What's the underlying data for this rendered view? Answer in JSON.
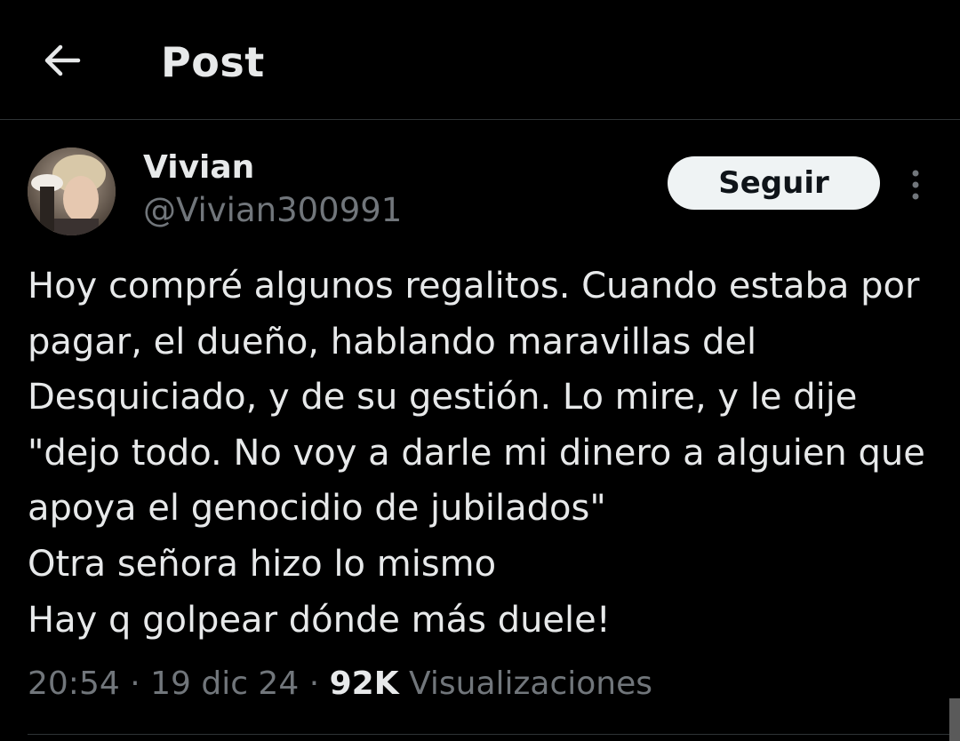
{
  "header": {
    "back_icon": "arrow-left-icon",
    "title": "Post"
  },
  "post": {
    "author": {
      "name": "Vivian",
      "handle": "@Vivian300991",
      "avatar": "user-avatar-photo"
    },
    "follow_label": "Seguir",
    "more_icon": "more-vertical-icon",
    "text": "Hoy compré algunos regalitos. Cuando estaba por pagar, el dueño, hablando maravillas del Desquiciado, y de su gestión. Lo mire, y le dije \"dejo todo. No voy a darle mi dinero a alguien que apoya el genocidio de jubilados\"\nOtra señora hizo lo mismo\nHay q golpear dónde más duele!",
    "meta": {
      "time": "20:54",
      "separator": " · ",
      "date": "19 dic 24",
      "views_count": "92K",
      "views_label": "Visualizaciones"
    }
  },
  "colors": {
    "background": "#000000",
    "primary_text": "#e7e9ea",
    "secondary_text": "#71767b",
    "follow_button_bg": "#eff3f4",
    "follow_button_text": "#0f1419",
    "divider": "#2f3336"
  }
}
